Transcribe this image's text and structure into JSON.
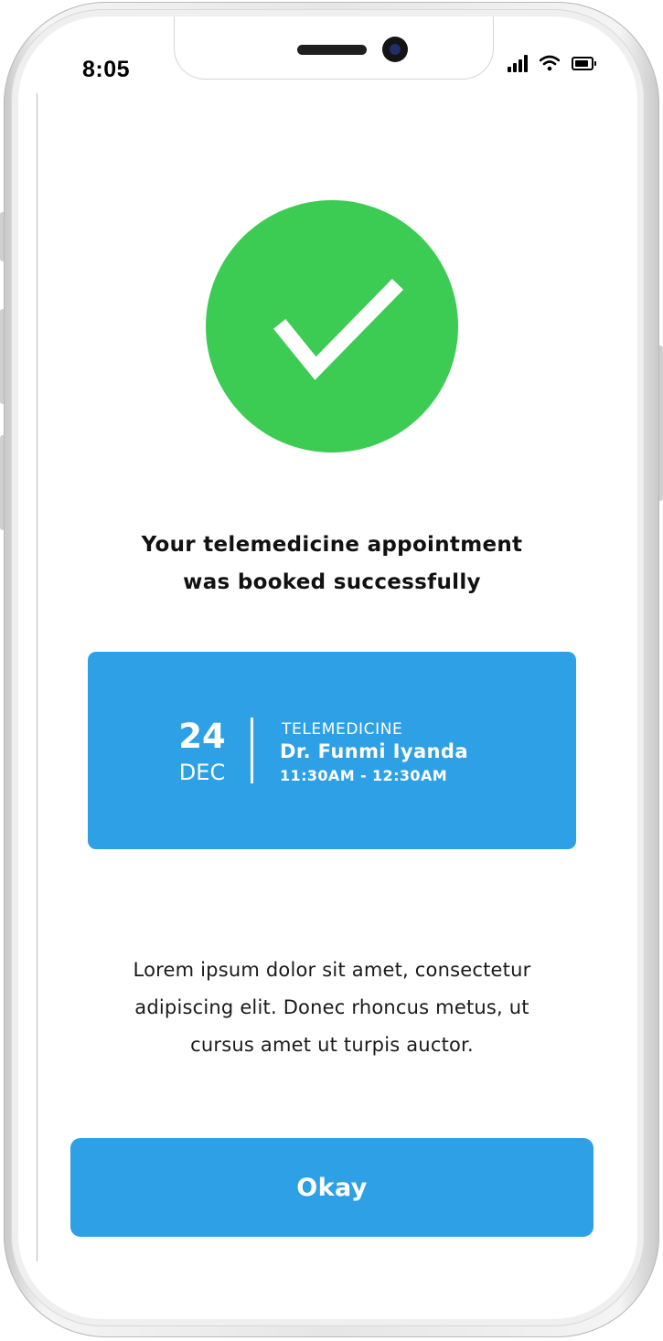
{
  "status_bar": {
    "time": "8:05",
    "icons": [
      "cellular-signal-icon",
      "wifi-icon",
      "battery-icon"
    ]
  },
  "success": {
    "icon": "checkmark-icon",
    "icon_color": "#3ccb53",
    "headline_line1": "Your telemedicine appointment",
    "headline_line2": "was booked successfully"
  },
  "appointment": {
    "day": "24",
    "month": "DEC",
    "type": "TELEMEDICINE",
    "doctor": "Dr. Funmi Iyanda",
    "time": "11:30AM - 12:30AM",
    "card_color": "#2ea1e6"
  },
  "description": {
    "line1": "Lorem ipsum dolor sit amet, consectetur",
    "line2": "adipiscing elit. Donec rhoncus metus, ut",
    "line3": "cursus amet ut turpis auctor."
  },
  "actions": {
    "okay_label": "Okay",
    "button_color": "#2ea1e6"
  }
}
